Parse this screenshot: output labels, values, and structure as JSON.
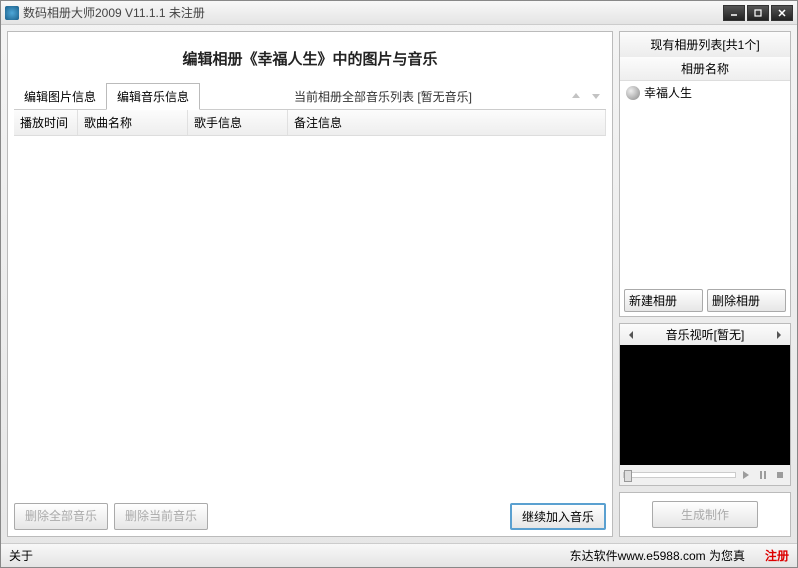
{
  "window": {
    "title": "数码相册大师2009  V11.1.1  未注册"
  },
  "main": {
    "title": "编辑相册《幸福人生》中的图片与音乐",
    "tabs": {
      "edit_image": "编辑图片信息",
      "edit_music": "编辑音乐信息"
    },
    "music_list_label": "当前相册全部音乐列表 [暂无音乐]",
    "columns": {
      "play_time": "播放时间",
      "song_name": "歌曲名称",
      "singer_info": "歌手信息",
      "remark": "备注信息"
    },
    "buttons": {
      "delete_all": "删除全部音乐",
      "delete_current": "删除当前音乐",
      "continue_add": "继续加入音乐"
    }
  },
  "side": {
    "album_list_title": "现有相册列表[共1个]",
    "album_header": "相册名称",
    "album_item": "幸福人生",
    "new_album": "新建相册",
    "delete_album": "删除相册",
    "preview_title": "音乐视听[暂无]",
    "generate": "生成制作"
  },
  "status": {
    "about": "关于",
    "company": "东达软件www.e5988.com 为您真",
    "register": "注册"
  }
}
